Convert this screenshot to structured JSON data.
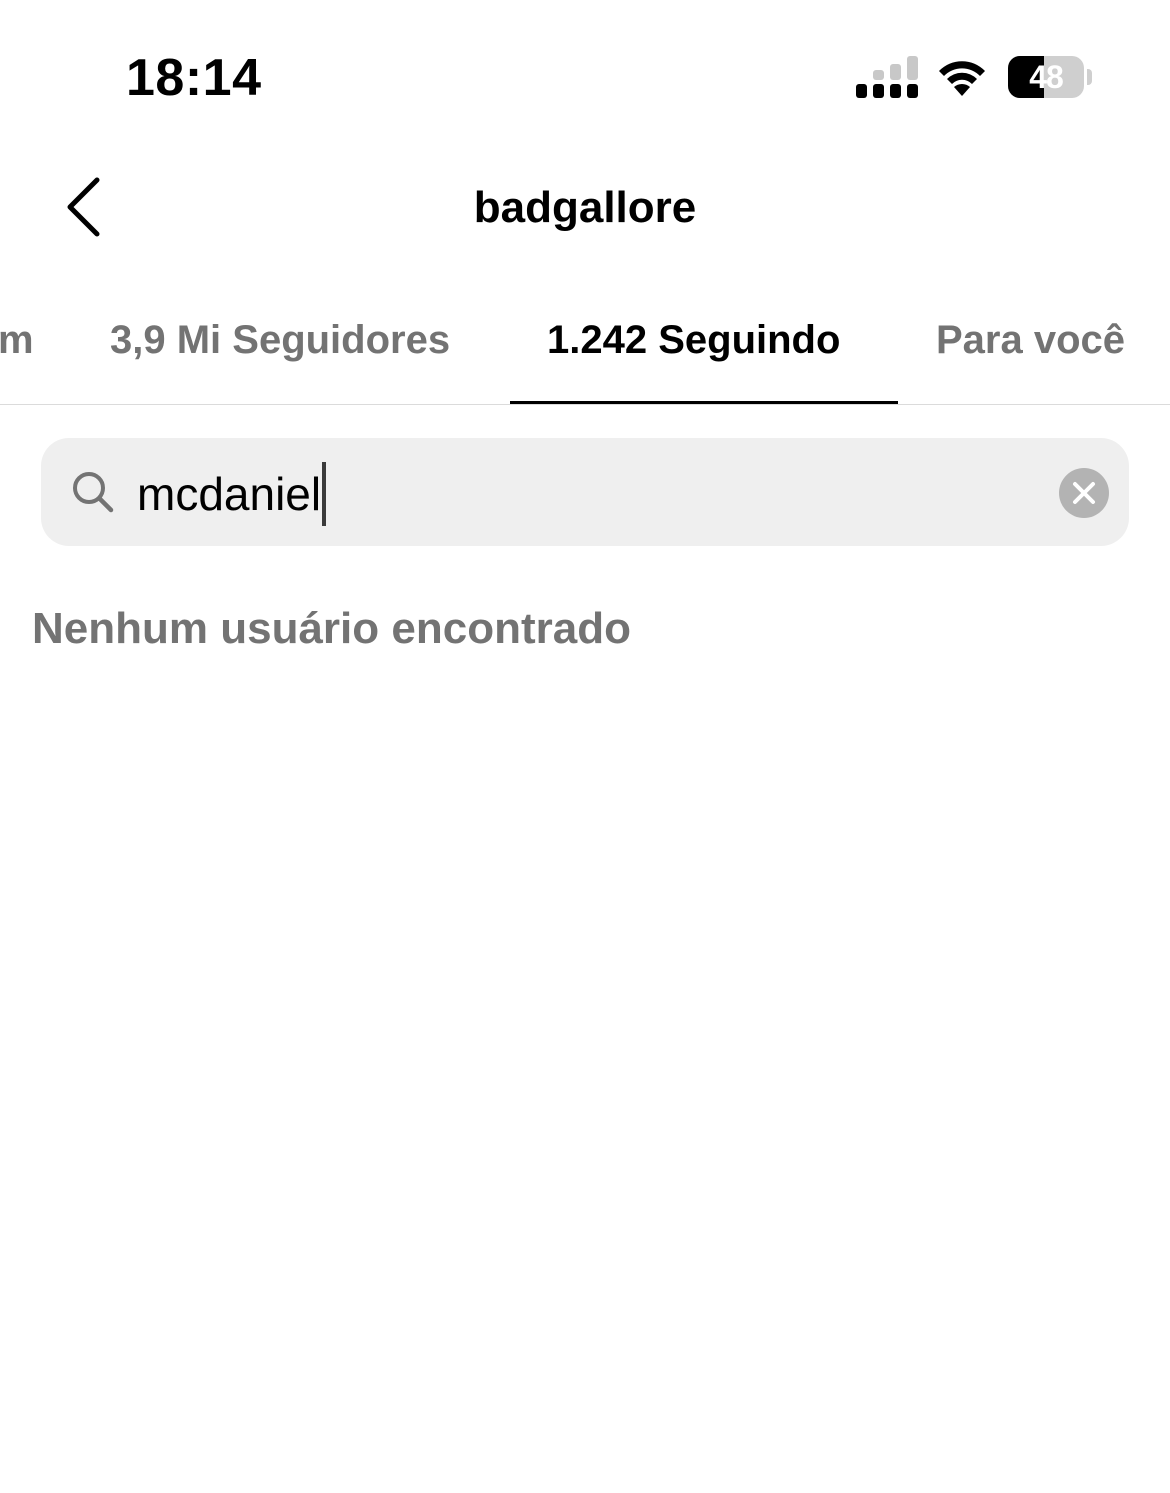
{
  "status_bar": {
    "time": "18:14",
    "battery_level": "48",
    "battery_fraction": 0.48,
    "icons": [
      "signal-icon",
      "wifi-icon",
      "battery-icon"
    ]
  },
  "header": {
    "title": "badgallore",
    "back_icon": "chevron-left-icon"
  },
  "tabs": [
    {
      "label": "m",
      "active": false
    },
    {
      "label": "3,9 Mi Seguidores",
      "active": false
    },
    {
      "label": "1.242 Seguindo",
      "active": true
    },
    {
      "label": "Para você",
      "active": false
    }
  ],
  "search": {
    "value": "mcdaniel",
    "icon": "search-icon",
    "clear_icon": "close-icon"
  },
  "results": {
    "empty_message": "Nenhum usuário encontrado"
  },
  "colors": {
    "active_text": "#000000",
    "inactive_text": "#737373",
    "search_background": "#efefef",
    "clear_button": "#b3b3b3"
  }
}
